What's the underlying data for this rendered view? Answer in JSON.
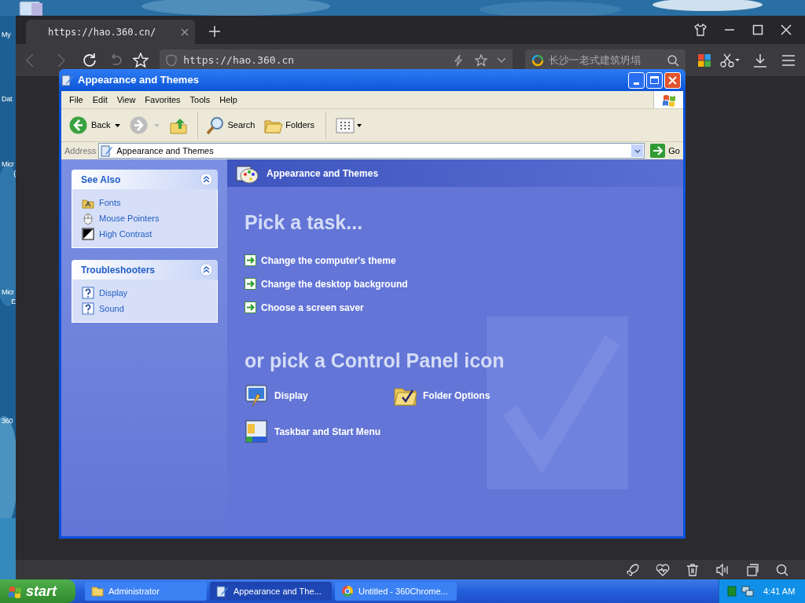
{
  "desktop": {
    "icons": [
      {
        "lines": [
          "My"
        ]
      },
      {
        "lines": [
          "Dat"
        ]
      },
      {
        "lines": [
          "Micr",
          "("
        ]
      },
      {
        "lines": [
          "Micr",
          "E"
        ]
      },
      {
        "lines": [
          "360"
        ]
      }
    ]
  },
  "browser": {
    "tabs": [
      {
        "title": "https://hao.360.cn/",
        "selected": true
      }
    ],
    "address": "https://hao.360.cn",
    "search_placeholder": "长沙一老式建筑坍塌"
  },
  "window": {
    "title": "Appearance and Themes",
    "menu": [
      "File",
      "Edit",
      "View",
      "Favorites",
      "Tools",
      "Help"
    ],
    "toolbar": [
      {
        "kind": "back",
        "label": "Back"
      },
      {
        "kind": "forward"
      },
      {
        "kind": "up"
      },
      {
        "kind": "search",
        "label": "Search"
      },
      {
        "kind": "folders",
        "label": "Folders"
      },
      {
        "kind": "views"
      }
    ],
    "address_label": "Address",
    "address": "Appearance and Themes",
    "go": "Go"
  },
  "side_panels": [
    {
      "title": "See Also",
      "expanded": true,
      "items": [
        {
          "kind": "fonts",
          "label": "Fonts"
        },
        {
          "kind": "mouse",
          "label": "Mouse Pointers"
        },
        {
          "kind": "contrast",
          "label": "High Contrast"
        }
      ]
    },
    {
      "title": "Troubleshooters",
      "expanded": true,
      "items": [
        {
          "kind": "help",
          "label": "Display"
        },
        {
          "kind": "help",
          "label": "Sound"
        }
      ]
    }
  ],
  "header": "Appearance and Themes",
  "task_heading": "Pick a task...",
  "tasks": [
    "Change the computer's theme",
    "Change the desktop background",
    "Choose a screen saver"
  ],
  "icons_heading": "or pick a Control Panel icon",
  "icons": [
    {
      "kind": "display",
      "label": "Display"
    },
    {
      "kind": "folder",
      "label": "Folder Options"
    },
    {
      "kind": "taskbar",
      "label": "Taskbar and Start Menu"
    }
  ],
  "taskbar": {
    "start": "start",
    "buttons": [
      {
        "kind": "folder",
        "label": "Administrator",
        "selected": false
      },
      {
        "kind": "control",
        "label": "Appearance and The...",
        "selected": true
      },
      {
        "kind": "browser",
        "label": "Untitled - 360Chrome...",
        "selected": false
      }
    ],
    "clock": "4:41 AM"
  }
}
